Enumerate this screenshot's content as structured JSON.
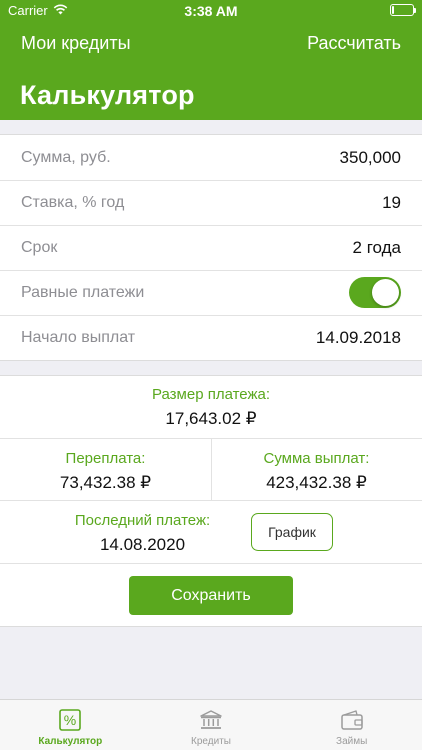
{
  "status": {
    "carrier": "Carrier",
    "time": "3:38 AM",
    "battery_level": 0.12
  },
  "nav": {
    "left": "Мои кредиты",
    "right": "Рассчитать"
  },
  "title": "Калькулятор",
  "form": {
    "rows": [
      {
        "label": "Сумма, руб.",
        "value": "350,000"
      },
      {
        "label": "Ставка, % год",
        "value": "19"
      },
      {
        "label": "Срок",
        "value": "2 года"
      },
      {
        "label": "Равные платежи",
        "toggle_on": true
      },
      {
        "label": "Начало выплат",
        "value": "14.09.2018"
      }
    ]
  },
  "results": {
    "payment_label": "Размер платежа:",
    "payment_value": "17,643.02 ₽",
    "overpay_label": "Переплата:",
    "overpay_value": "73,432.38 ₽",
    "total_label": "Сумма выплат:",
    "total_value": "423,432.38 ₽",
    "last_label": "Последний платеж:",
    "last_value": "14.08.2020",
    "schedule_button": "График",
    "save_button": "Сохранить"
  },
  "tabs": [
    {
      "label": "Калькулятор",
      "icon": "percent-icon",
      "active": true
    },
    {
      "label": "Кредиты",
      "icon": "bank-icon",
      "active": false
    },
    {
      "label": "Займы",
      "icon": "wallet-icon",
      "active": false
    }
  ],
  "colors": {
    "accent": "#5aa81e",
    "inactive": "#9b9b9b"
  }
}
